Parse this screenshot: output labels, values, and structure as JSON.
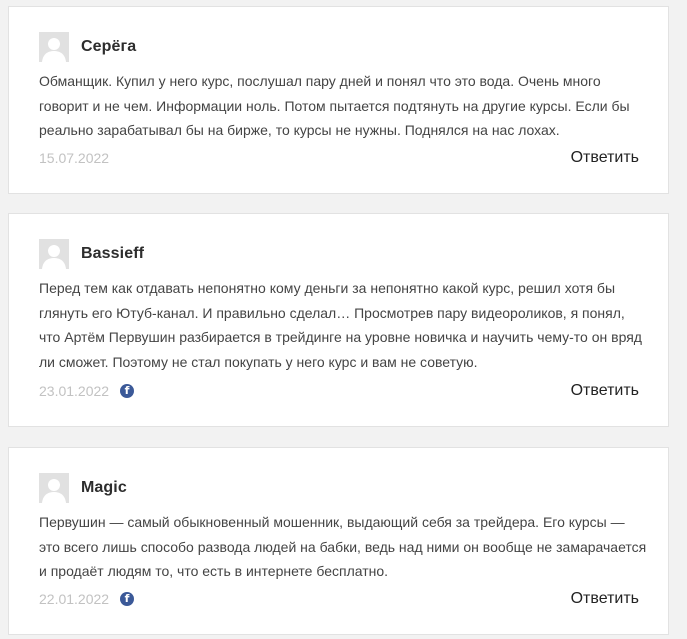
{
  "comments": [
    {
      "author": "Серёга",
      "text": "Обманщик. Купил у него курс, послушал пару дней и понял что это вода. Очень много говорит и не чем. Информации ноль. Потом пытается подтянуть на другие курсы. Если бы реально зарабатывал бы на бирже, то курсы не нужны. Поднялся на нас лохах.",
      "date": "15.07.2022",
      "reply_label": "Ответить",
      "social_icon": ""
    },
    {
      "author": "Bassieff",
      "text": "Перед тем как отдавать непонятно кому деньги за непонятно какой курс, решил хотя бы глянуть его Ютуб-канал. И правильно сделал… Просмотрев пару видеороликов, я понял, что Артём Первушин разбирается в трейдинге на уровне новичка и научить чему-то он вряд ли сможет. Поэтому не стал покупать у него курс и вам не советую.",
      "date": "23.01.2022",
      "reply_label": "Ответить",
      "social_icon": "f"
    },
    {
      "author": "Magic",
      "text": "Первушин — самый обыкновенный мошенник, выдающий себя за трейдера. Его курсы — это всего лишь способо развода людей на бабки, ведь над ними он вообще не замарачается и продаёт людям то, что есть в интернете бесплатно.",
      "date": "22.01.2022",
      "reply_label": "Ответить",
      "social_icon": "f"
    }
  ],
  "colors": {
    "background": "#f2f2f2",
    "card": "#ffffff",
    "date": "#c2c2c2",
    "facebook": "#3b5998",
    "avatar": "#e1e1e1"
  }
}
